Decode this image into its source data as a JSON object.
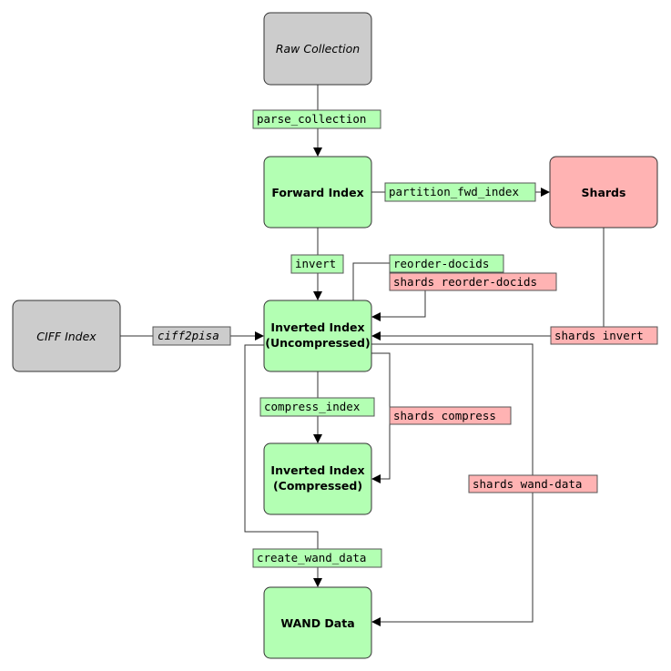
{
  "colors": {
    "neutral": "#cccccc",
    "pisa": "#b3ffb3",
    "shards": "#ffb3b3"
  },
  "nodes": {
    "raw_collection": "Raw Collection",
    "forward_index": "Forward Index",
    "shards": "Shards",
    "ciff_index": "CIFF Index",
    "inverted_uncompressed": [
      "Inverted Index",
      "(Uncompressed)"
    ],
    "inverted_compressed": [
      "Inverted Index",
      "(Compressed)"
    ],
    "wand_data": "WAND Data"
  },
  "edges": {
    "parse_collection": "parse_collection",
    "partition_fwd_index": "partition_fwd_index",
    "invert": "invert",
    "reorder_docids": "reorder-docids",
    "shards_reorder_docids": "shards reorder-docids",
    "ciff2pisa": "ciff2pisa",
    "shards_invert": "shards invert",
    "compress_index": "compress_index",
    "shards_compress": "shards compress",
    "shards_wand_data": "shards wand-data",
    "create_wand_data": "create_wand_data"
  }
}
